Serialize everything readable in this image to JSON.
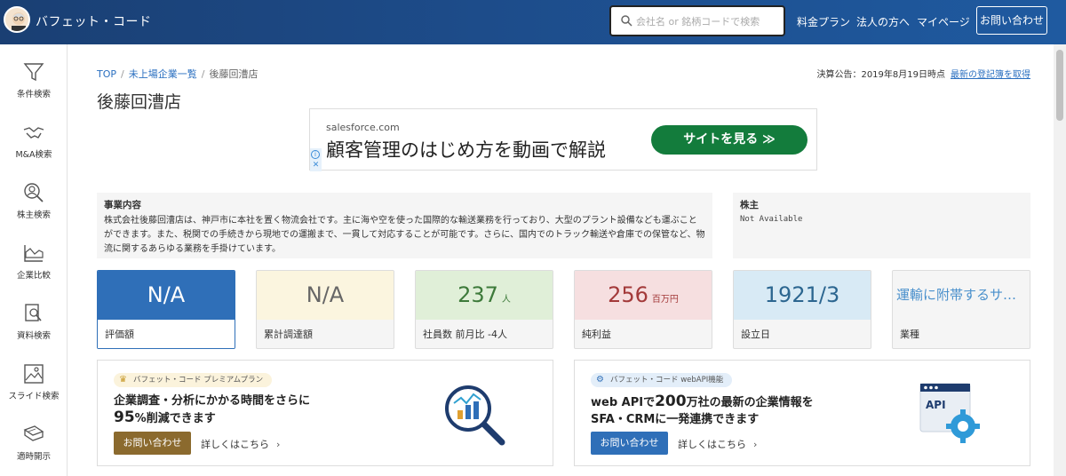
{
  "header": {
    "brand": "バフェット・コード",
    "search_placeholder": "会社名 or 銘柄コードで検索",
    "nav": [
      "料金プラン",
      "法人の方へ",
      "マイページ"
    ],
    "contact_label": "お問い合わせ"
  },
  "sidebar": {
    "items": [
      {
        "label": "条件検索",
        "icon": "filter-icon"
      },
      {
        "label": "M&A検索",
        "icon": "handshake-icon"
      },
      {
        "label": "株主検索",
        "icon": "person-search-icon"
      },
      {
        "label": "企業比較",
        "icon": "compare-chart-icon"
      },
      {
        "label": "資料検索",
        "icon": "document-search-icon"
      },
      {
        "label": "スライド検索",
        "icon": "image-icon"
      },
      {
        "label": "適時開示",
        "icon": "newspaper-icon"
      }
    ]
  },
  "breadcrumb": {
    "items": [
      "TOP",
      "未上場企業一覧",
      "後藤回漕店"
    ]
  },
  "announcement": {
    "text": "決算公告：2019年8月19日時点",
    "link": "最新の登記簿を取得"
  },
  "page_title": "後藤回漕店",
  "ad": {
    "domain": "salesforce.com",
    "headline": "顧客管理のはじめ方を動画で解説",
    "button": "サイトを見る ≫"
  },
  "business": {
    "heading": "事業内容",
    "text": "株式会社後藤回漕店は、神戸市に本社を置く物流会社です。主に海や空を使った国際的な輸送業務を行っており、大型のプラント設備なども運ぶことができます。また、税関での手続きから現地での運搬まで、一貫して対応することが可能です。さらに、国内でのトラック輸送や倉庫での保管など、物流に関するあらゆる業務を手掛けています。"
  },
  "shareholders": {
    "heading": "株主",
    "text": "Not Available"
  },
  "cards": [
    {
      "value": "N/A",
      "unit": "",
      "label": "評価額"
    },
    {
      "value": "N/A",
      "unit": "",
      "label": "累計調達額"
    },
    {
      "value": "237",
      "unit": "人",
      "label": "社員数 前月比 -4人"
    },
    {
      "value": "256",
      "unit": "百万円",
      "label": "純利益"
    },
    {
      "value": "1921/3",
      "unit": "",
      "label": "設立日"
    },
    {
      "value": "運輸に附帯するサー...",
      "unit": "",
      "label": "業種"
    }
  ],
  "promo_premium": {
    "tag": "バフェット・コード プレミアムプラン",
    "line1": "企業調査・分析にかかる時間をさらに",
    "line2_big": "95",
    "line2_rest": "%削減できます",
    "button": "お問い合わせ",
    "link": "詳しくはこちら",
    "accent": "#8b6a2e"
  },
  "promo_api": {
    "tag": "バフェット・コード webAPI機能",
    "line1_pre": "web APIで",
    "line1_big": "200",
    "line1_post": "万社の最新の企業情報を",
    "line2": "SFA・CRMに一発連携できます",
    "button": "お問い合わせ",
    "link": "詳しくはこちら",
    "illustration_label": "API",
    "accent": "#2f6fb8"
  }
}
